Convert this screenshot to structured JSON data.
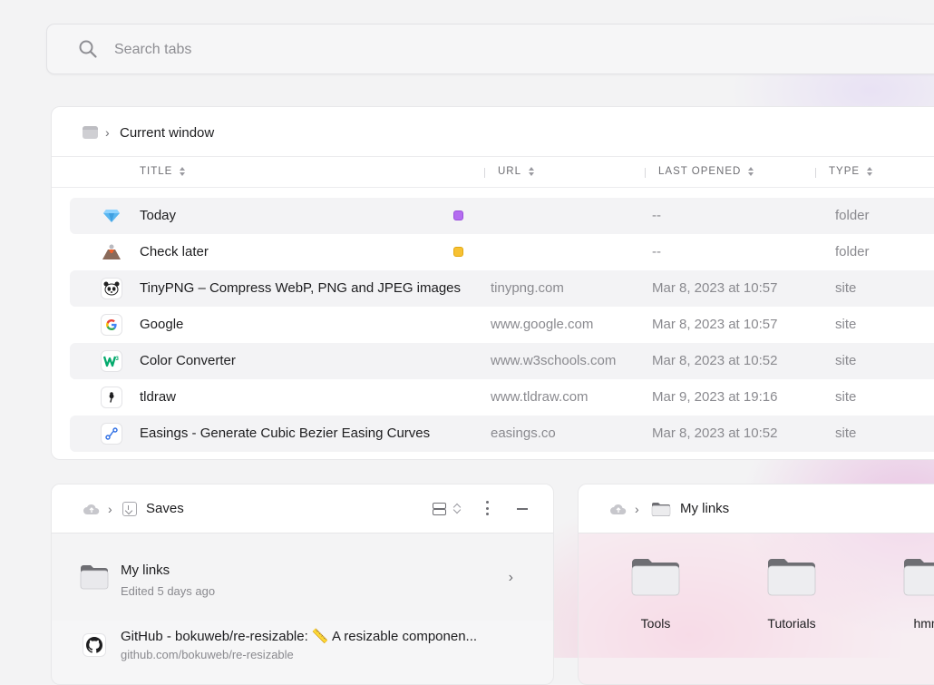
{
  "search": {
    "placeholder": "Search tabs"
  },
  "current_window": {
    "breadcrumb_label": "Current window",
    "columns": {
      "title": "TITLE",
      "url": "URL",
      "last_opened": "LAST OPENED",
      "type": "TYPE"
    },
    "rows": [
      {
        "title": "Today",
        "url": "",
        "last_opened": "--",
        "type": "folder",
        "icon": "gem-icon",
        "tag_color": "#b46cf0"
      },
      {
        "title": "Check later",
        "url": "",
        "last_opened": "--",
        "type": "folder",
        "icon": "volcano-icon",
        "tag_color": "#f7c133"
      },
      {
        "title": "TinyPNG – Compress WebP, PNG and JPEG images",
        "url": "tinypng.com",
        "last_opened": "Mar 8, 2023 at 10:57",
        "type": "site",
        "icon": "panda-icon"
      },
      {
        "title": "Google",
        "url": "www.google.com",
        "last_opened": "Mar 8, 2023 at 10:57",
        "type": "site",
        "icon": "google-icon"
      },
      {
        "title": "Color Converter",
        "url": "www.w3schools.com",
        "last_opened": "Mar 8, 2023 at 10:52",
        "type": "site",
        "icon": "w3schools-icon"
      },
      {
        "title": "tldraw",
        "url": "www.tldraw.com",
        "last_opened": "Mar 9, 2023 at 19:16",
        "type": "site",
        "icon": "tldraw-icon"
      },
      {
        "title": "Easings - Generate Cubic Bezier Easing Curves",
        "url": "easings.co",
        "last_opened": "Mar 8, 2023 at 10:52",
        "type": "site",
        "icon": "easings-icon"
      }
    ]
  },
  "saves_panel": {
    "title": "Saves",
    "items": [
      {
        "name": "My links",
        "sub": "Edited 5 days ago"
      },
      {
        "name": "GitHub - bokuweb/re-resizable: 📏 A resizable componen...",
        "sub": "github.com/bokuweb/re-resizable"
      }
    ]
  },
  "links_panel": {
    "title": "My links",
    "folders": [
      "Tools",
      "Tutorials",
      "hmm"
    ]
  }
}
